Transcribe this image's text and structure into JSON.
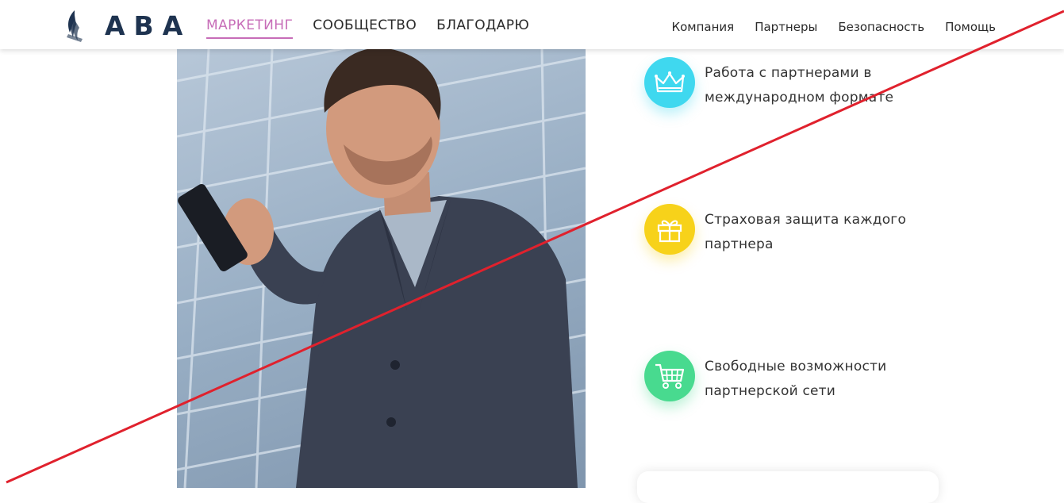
{
  "header": {
    "logo_text": "ABA",
    "main_nav": [
      {
        "label": "МАРКЕТИНГ",
        "active": true
      },
      {
        "label": "СООБЩЕСТВО",
        "active": false
      },
      {
        "label": "БЛАГОДАРЮ",
        "active": false
      }
    ],
    "secondary_nav": [
      {
        "label": "Компания"
      },
      {
        "label": "Партнеры"
      },
      {
        "label": "Безопасность"
      },
      {
        "label": "Помощь"
      }
    ]
  },
  "hero_photo": {
    "icon": "photo-man-with-smartphone"
  },
  "features": [
    {
      "text": "Работа с партнерами в международном формате",
      "icon": "crown-icon",
      "color": "#3fd8ef"
    },
    {
      "text": "Страховая защита каждого партнера",
      "icon": "gift-icon",
      "color": "#f7d21a"
    },
    {
      "text": "Свободные возможности партнерской сети",
      "icon": "cart-icon",
      "color": "#48da8f"
    }
  ],
  "colors": {
    "accent": "#c76db8",
    "logo": "#1e3350",
    "strike_line": "#e0212d"
  }
}
